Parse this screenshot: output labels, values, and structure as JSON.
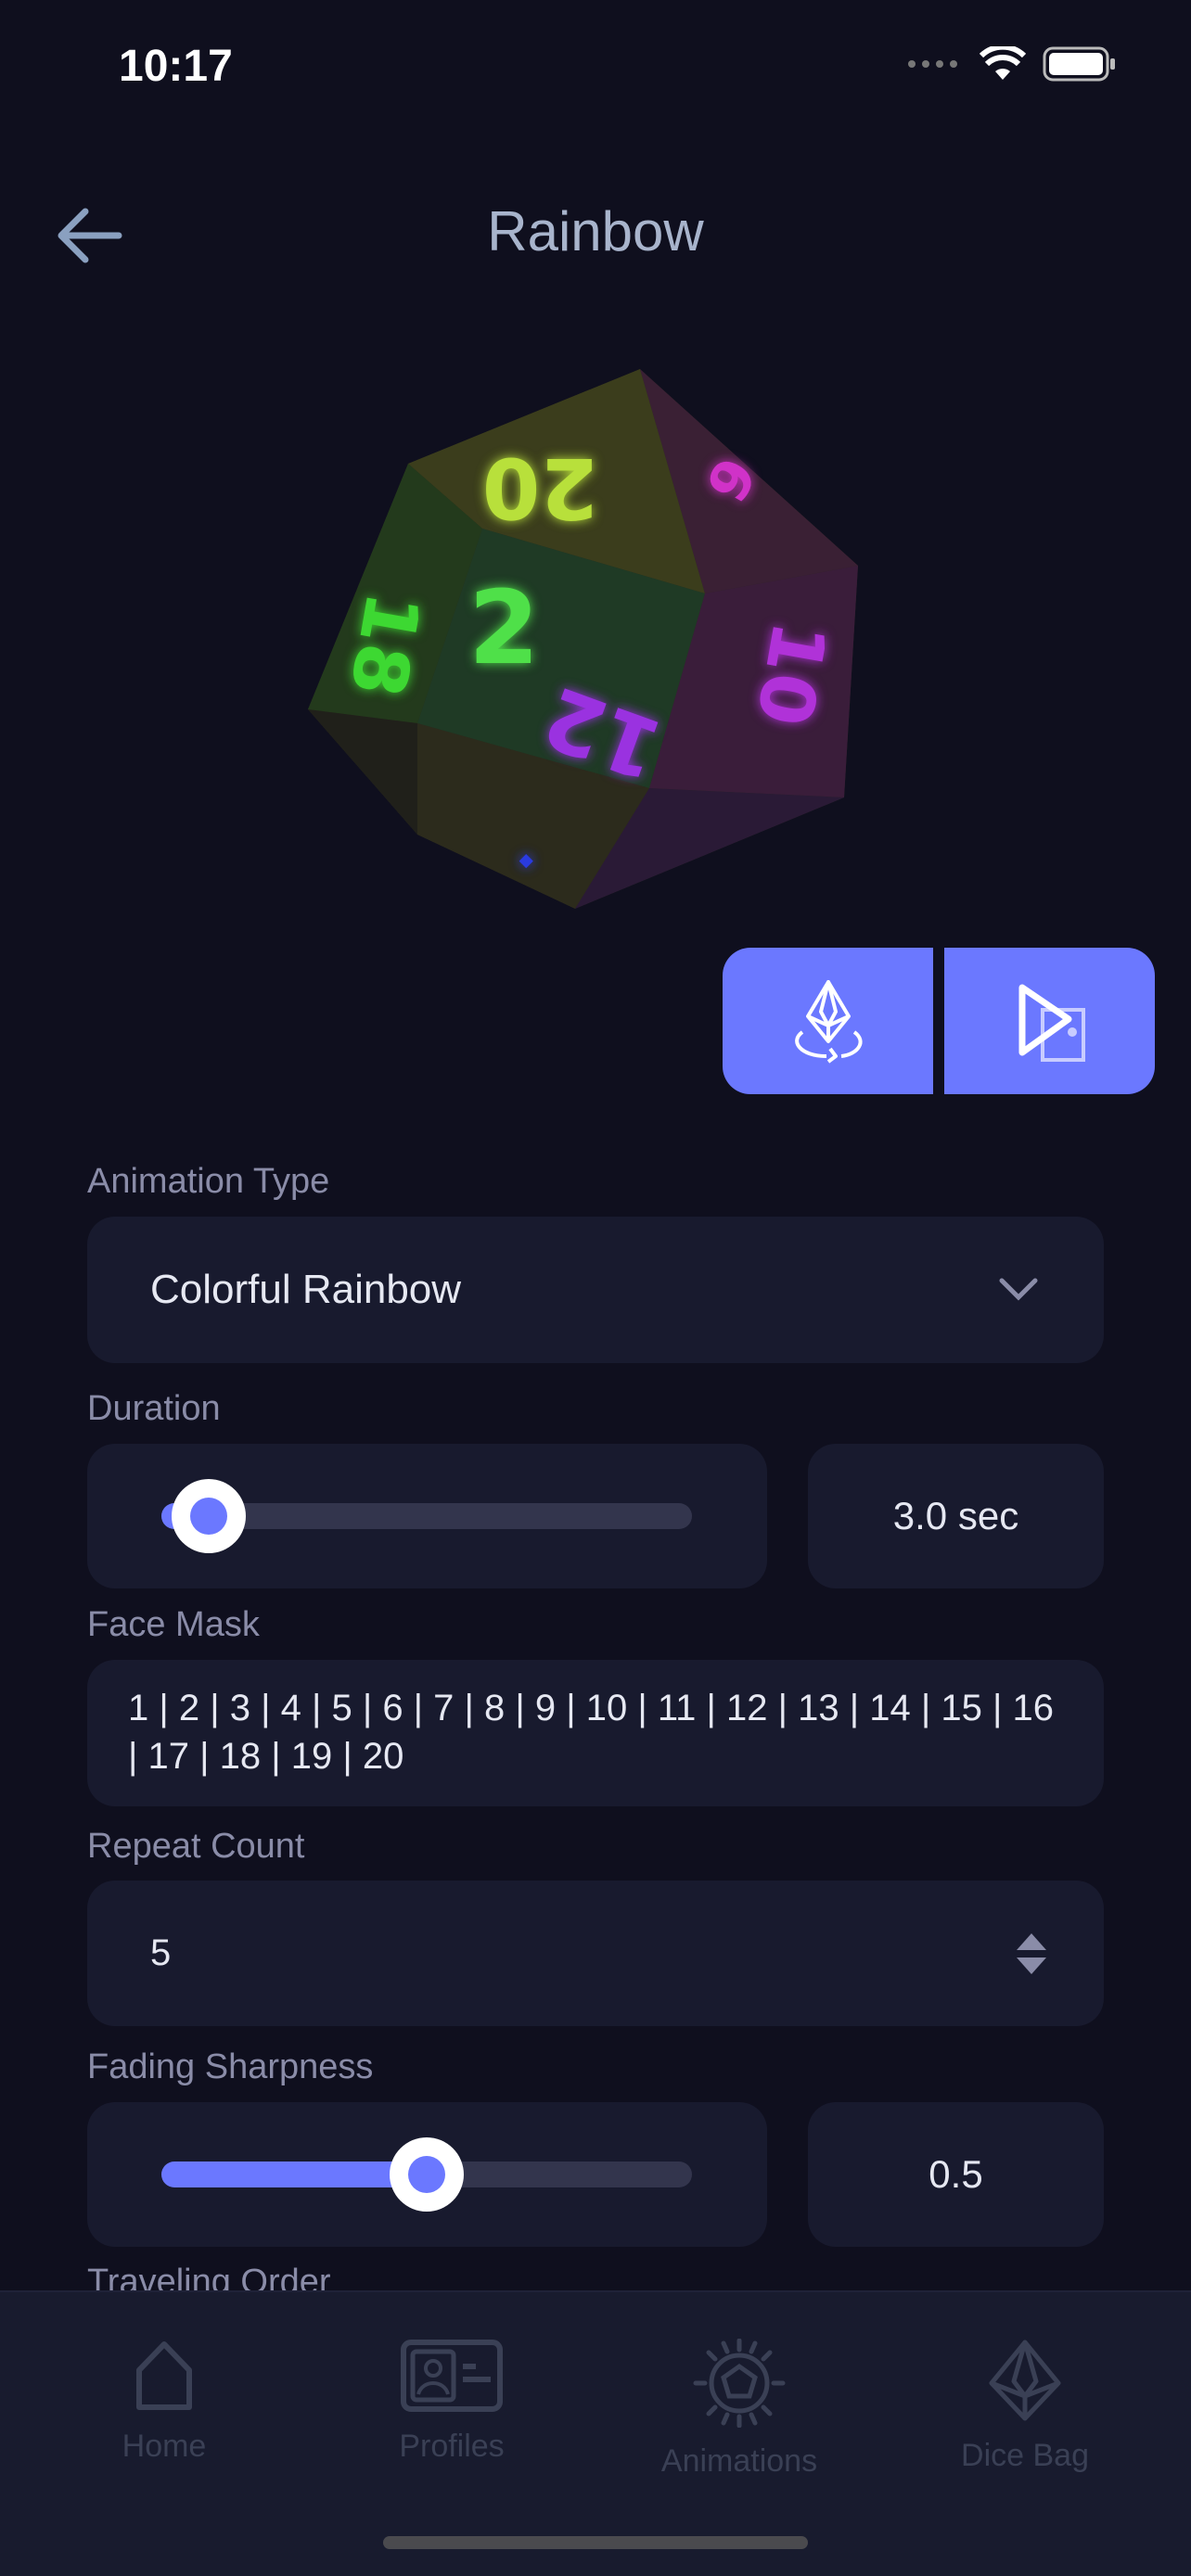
{
  "status_bar": {
    "time": "10:17"
  },
  "header": {
    "title": "Rainbow",
    "back_icon": "arrow-left-icon"
  },
  "preview": {
    "die_faces_visible": [
      "20",
      "2",
      "18",
      "6",
      "12",
      "10"
    ]
  },
  "actions": [
    {
      "icon": "rotate-die-icon"
    },
    {
      "icon": "play-on-die-icon"
    }
  ],
  "form": {
    "animation_type": {
      "label": "Animation Type",
      "value": "Colorful Rainbow"
    },
    "duration": {
      "label": "Duration",
      "value_text": "3.0 sec",
      "slider_fraction": 0.09
    },
    "face_mask": {
      "label": "Face Mask",
      "value": "1 | 2 | 3 | 4 | 5 | 6 | 7 | 8 | 9 | 10 | 11 | 12 | 13 | 14 | 15 | 16 | 17 | 18 | 19 | 20"
    },
    "repeat_count": {
      "label": "Repeat Count",
      "value": "5"
    },
    "fading_sharpness": {
      "label": "Fading Sharpness",
      "value_text": "0.5",
      "slider_fraction": 0.5
    },
    "traveling_order": {
      "label": "Traveling Order"
    }
  },
  "tabbar": {
    "items": [
      {
        "label": "Home",
        "icon": "home-icon"
      },
      {
        "label": "Profiles",
        "icon": "profile-card-icon"
      },
      {
        "label": "Animations",
        "icon": "animations-icon"
      },
      {
        "label": "Dice Bag",
        "icon": "dice-bag-icon"
      }
    ]
  },
  "colors": {
    "background": "#0f0f1e",
    "card": "#181a2e",
    "accent": "#6b78ff",
    "track": "#33354d",
    "tab_inactive": "#3a4055"
  }
}
